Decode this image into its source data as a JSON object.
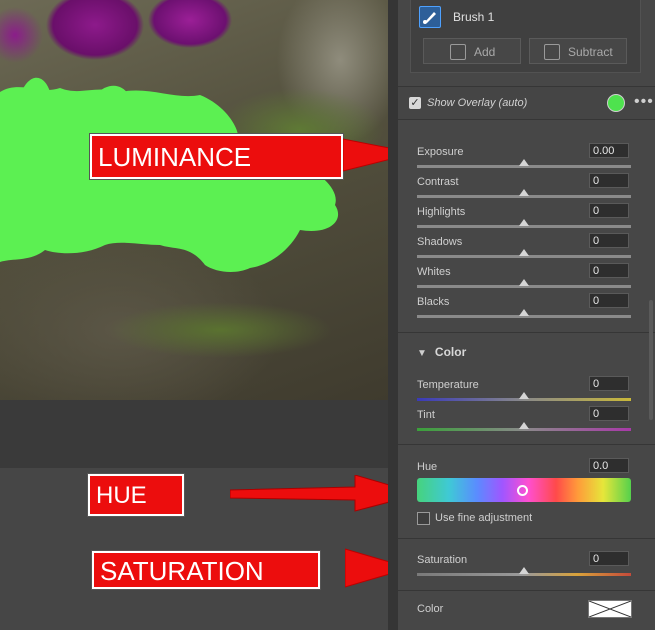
{
  "brush_panel": {
    "brush_name": "Brush 1",
    "add_label": "Add",
    "subtract_label": "Subtract"
  },
  "overlay": {
    "label": "Show Overlay (auto)",
    "checked": true,
    "color": "#4ee24e",
    "more_label": "•••"
  },
  "light_sliders": [
    {
      "name": "Exposure",
      "value": "0.00"
    },
    {
      "name": "Contrast",
      "value": "0"
    },
    {
      "name": "Highlights",
      "value": "0"
    },
    {
      "name": "Shadows",
      "value": "0"
    },
    {
      "name": "Whites",
      "value": "0"
    },
    {
      "name": "Blacks",
      "value": "0"
    }
  ],
  "color_section": {
    "title": "Color",
    "temperature": {
      "name": "Temperature",
      "value": "0"
    },
    "tint": {
      "name": "Tint",
      "value": "0"
    },
    "hue": {
      "name": "Hue",
      "value": "0.0"
    },
    "fine_adjustment_label": "Use fine adjustment",
    "saturation": {
      "name": "Saturation",
      "value": "0"
    },
    "color_label": "Color"
  },
  "callouts": {
    "luminance": "LUMINANCE",
    "hue": "HUE",
    "saturation": "SATURATION"
  },
  "colors": {
    "callout_red": "#ec0d0d",
    "mask_green": "#5cf052"
  }
}
